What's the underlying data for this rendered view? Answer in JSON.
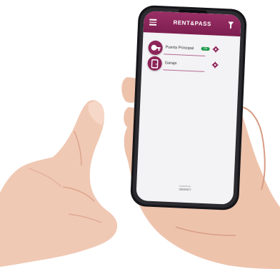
{
  "app": {
    "brand": "RENT&PASS",
    "menu_icon": "hamburger-menu-icon",
    "filter_icon": "filter-icon"
  },
  "doors": [
    {
      "label": "Puerta Principal",
      "status": "ON",
      "icon": "door-icon"
    },
    {
      "label": "Garaje",
      "status": "",
      "icon": "door-icon"
    }
  ],
  "footer": {
    "powered_by": "powered by",
    "brand": "ISEEKEY"
  },
  "colors": {
    "accent": "#8c2459",
    "badge": "#1f9a48",
    "screen_bg": "#f3f2f4"
  }
}
